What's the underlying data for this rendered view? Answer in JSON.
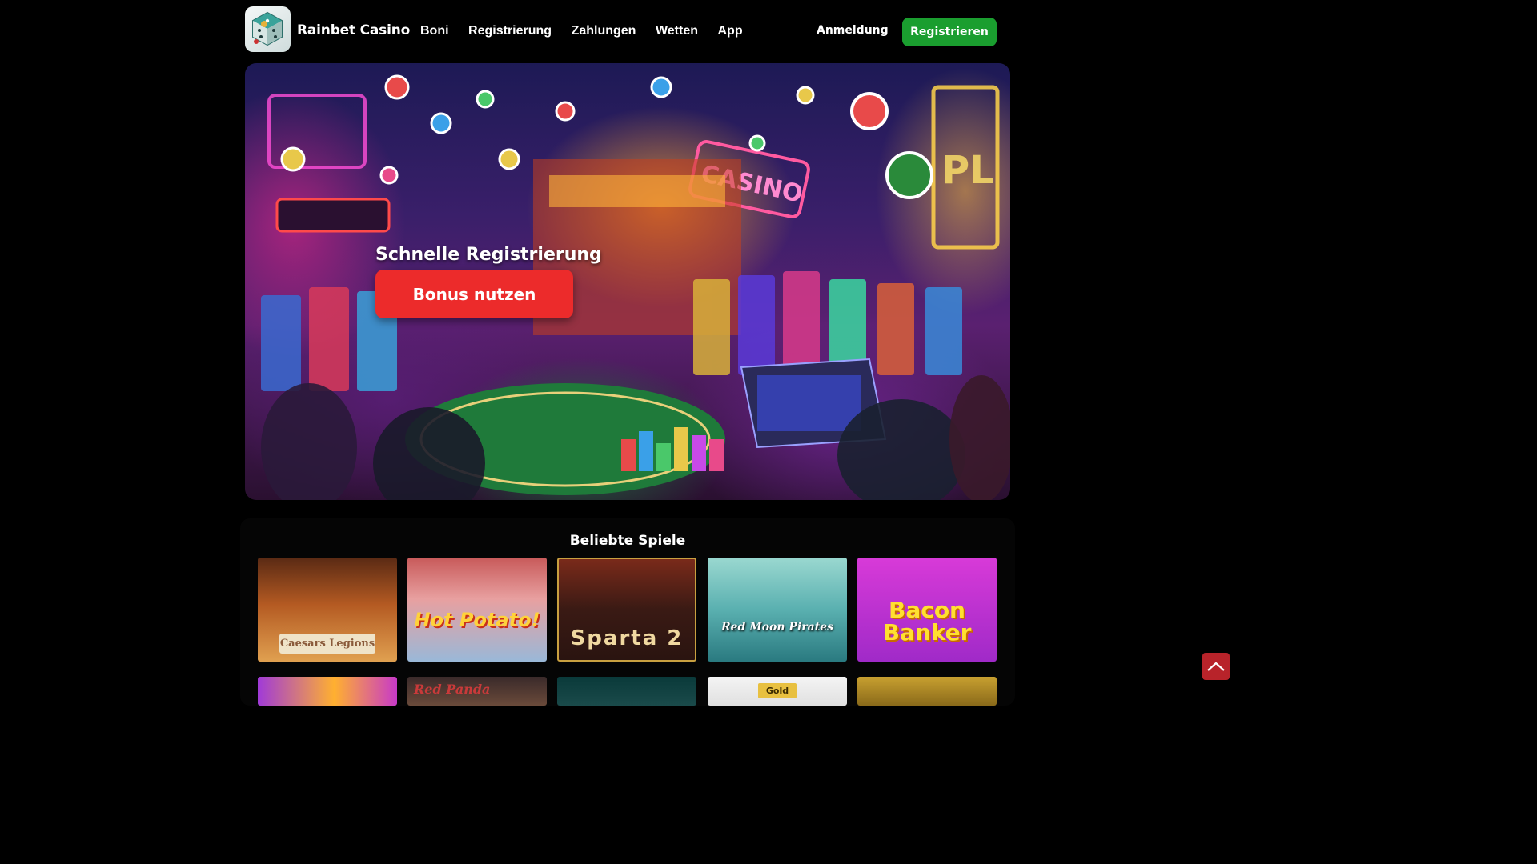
{
  "header": {
    "brand": "Rainbet Casino",
    "nav": [
      "Boni",
      "Registrierung",
      "Zahlungen",
      "Wetten",
      "App"
    ],
    "login_label": "Anmeldung",
    "register_label": "Registrieren"
  },
  "hero": {
    "title": "Schnelle Registrierung",
    "cta_label": "Bonus nutzen"
  },
  "games": {
    "title": "Beliebte Spiele",
    "row1": [
      {
        "name": "Caesars Legions"
      },
      {
        "name": "Hot Potato!"
      },
      {
        "name": "Sparta 2"
      },
      {
        "name": "Red Moon Pirates"
      },
      {
        "name": "Bacon Banker"
      }
    ],
    "row2": [
      {
        "name": ""
      },
      {
        "name": "Red Panda"
      },
      {
        "name": ""
      },
      {
        "name": "Gold"
      },
      {
        "name": ""
      }
    ]
  },
  "colors": {
    "register": "#1a9e2f",
    "cta": "#ec2b2b",
    "scroll_top": "#b8232a"
  }
}
